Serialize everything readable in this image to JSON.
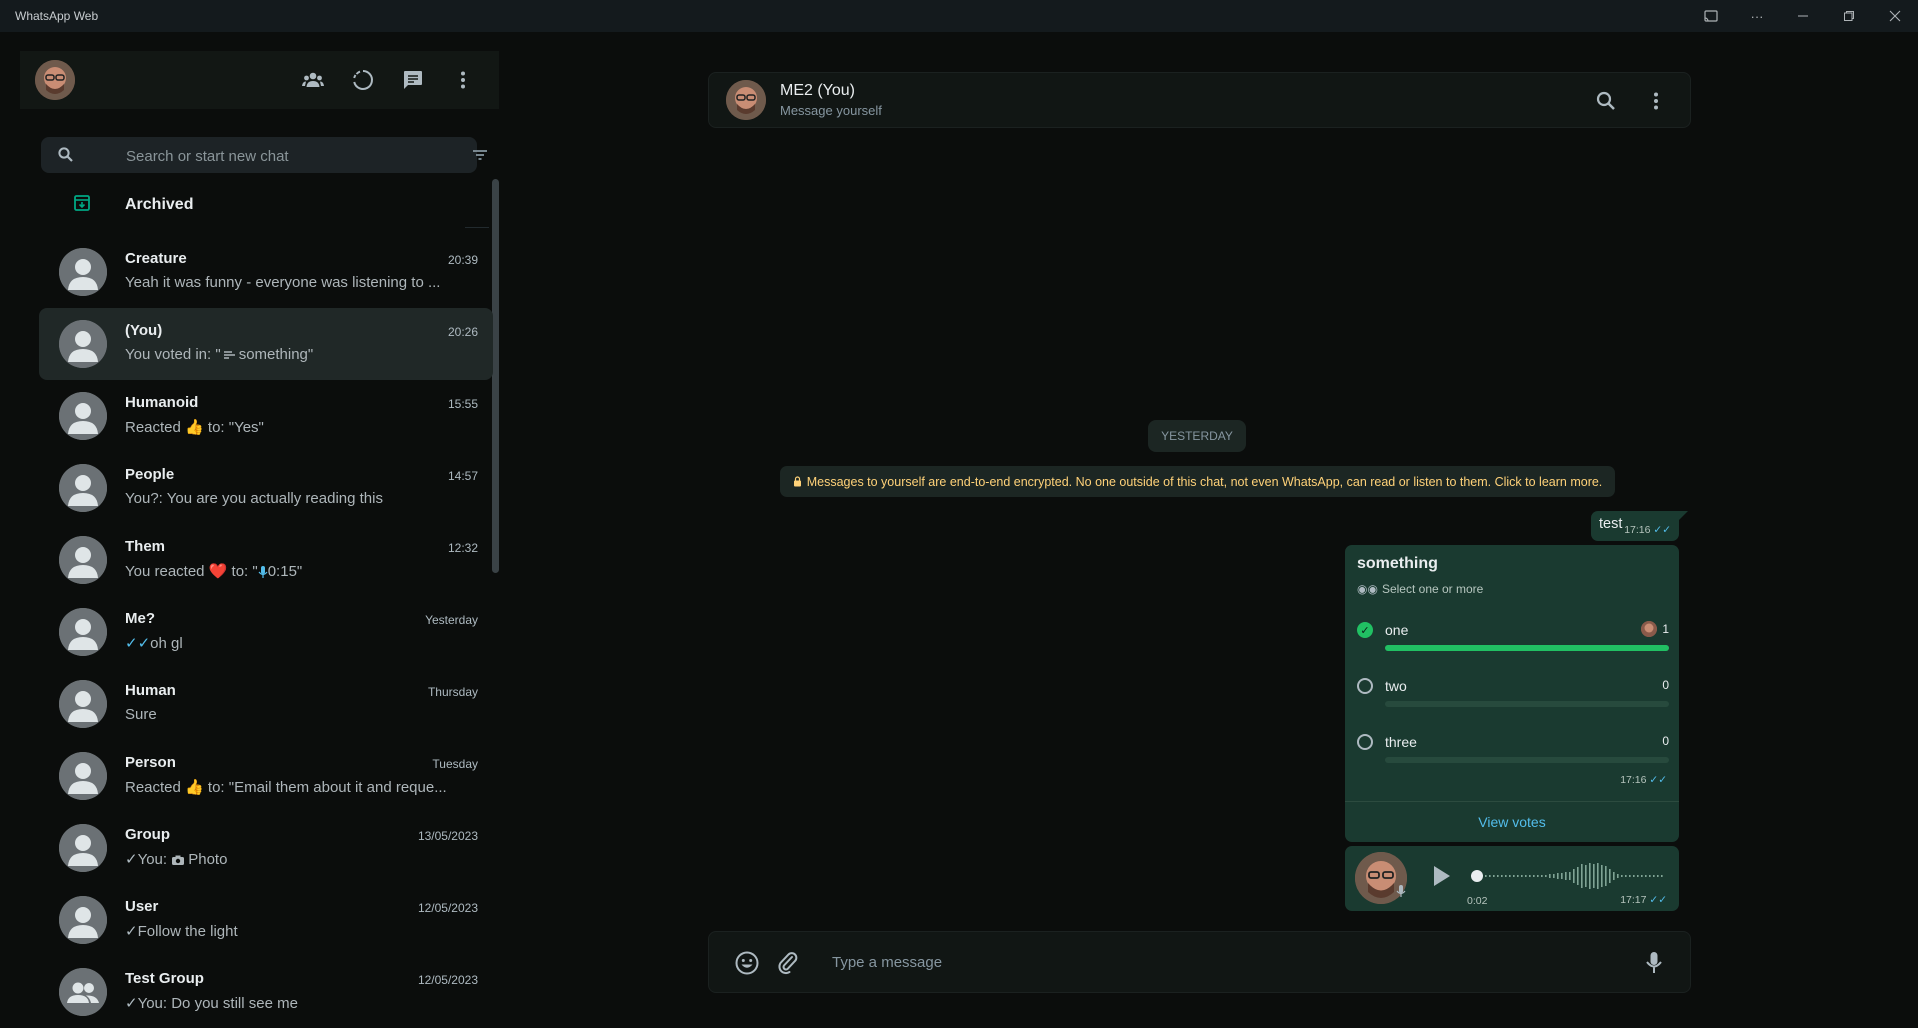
{
  "window": {
    "title": "WhatsApp Web",
    "controls": [
      "cast-icon",
      "more-icon",
      "minimize-icon",
      "maximize-icon",
      "close-icon"
    ]
  },
  "sidebar": {
    "header_icons": [
      "communities-icon",
      "status-icon",
      "new-chat-icon",
      "menu-icon"
    ],
    "search": {
      "placeholder": "Search or start new chat"
    },
    "archived_label": "Archived",
    "chats": [
      {
        "name": "Creature",
        "time": "20:39",
        "preview": "Yeah it was funny - everyone was listening to ..."
      },
      {
        "name": " (You)",
        "time": "20:26",
        "preview_prefix": "You voted in: \"",
        "preview_icon": "poll-icon",
        "preview": "something\"",
        "selected": true
      },
      {
        "name": "Humanoid",
        "time": "15:55",
        "preview_prefix": "Reacted ",
        "preview_emoji": "👍",
        "preview": " to: \"Yes\""
      },
      {
        "name": "People",
        "time": "14:57",
        "preview": "You?: You are you actually reading this"
      },
      {
        "name": "Them",
        "time": "12:32",
        "preview_prefix": "You reacted ",
        "preview_emoji": "❤️",
        "preview_mid": " to: \"",
        "preview_icon": "mic-icon",
        "preview": "0:15\""
      },
      {
        "name": "Me?",
        "time": "Yesterday",
        "preview_tick": "✓✓",
        "preview": "oh gl"
      },
      {
        "name": "Human",
        "time": "Thursday",
        "preview": "Sure"
      },
      {
        "name": "Person",
        "time": "Tuesday",
        "preview_prefix": "Reacted ",
        "preview_emoji": "👍",
        "preview": " to: \"Email them about it and reque..."
      },
      {
        "name": "Group",
        "time": "13/05/2023",
        "preview_tick": "✓",
        "preview_prefix": "You: ",
        "preview_icon": "camera-icon",
        "preview": "Photo"
      },
      {
        "name": "User",
        "time": "12/05/2023",
        "preview_tick": "✓",
        "preview": "Follow the light"
      },
      {
        "name": "Test Group",
        "time": "12/05/2023",
        "preview_tick": "✓",
        "preview": "You: Do you still see me",
        "group": true
      }
    ]
  },
  "conversation": {
    "name": "ME2 (You)",
    "subtitle": "Message yourself",
    "header_icons": [
      "search-icon",
      "menu-icon"
    ],
    "day_divider": "YESTERDAY",
    "encryption_note": "Messages to yourself are end-to-end encrypted. No one outside of this chat, not even WhatsApp, can read or listen to them. Click to learn more.",
    "messages": {
      "text": {
        "body": "test",
        "time": "17:16"
      },
      "poll": {
        "title": "something",
        "subtitle": "Select one or more",
        "options": [
          {
            "label": "one",
            "count": "1",
            "checked": true,
            "fraction": 1.0
          },
          {
            "label": "two",
            "count": "0",
            "checked": false,
            "fraction": 0.0
          },
          {
            "label": "three",
            "count": "0",
            "checked": false,
            "fraction": 0.0
          }
        ],
        "time": "17:16",
        "view_votes": "View votes"
      },
      "voice": {
        "duration": "0:02",
        "time": "17:17",
        "progress": 0.0
      }
    }
  },
  "composer": {
    "placeholder": "Type a message",
    "icons": [
      "emoji-icon",
      "attach-icon",
      "mic-icon"
    ]
  },
  "colors": {
    "accent": "#00a884",
    "bubble_out": "#1a3a30",
    "read_tick": "#53bdeb",
    "poll_fill": "#21c063",
    "encryption_text": "#ffd279"
  }
}
